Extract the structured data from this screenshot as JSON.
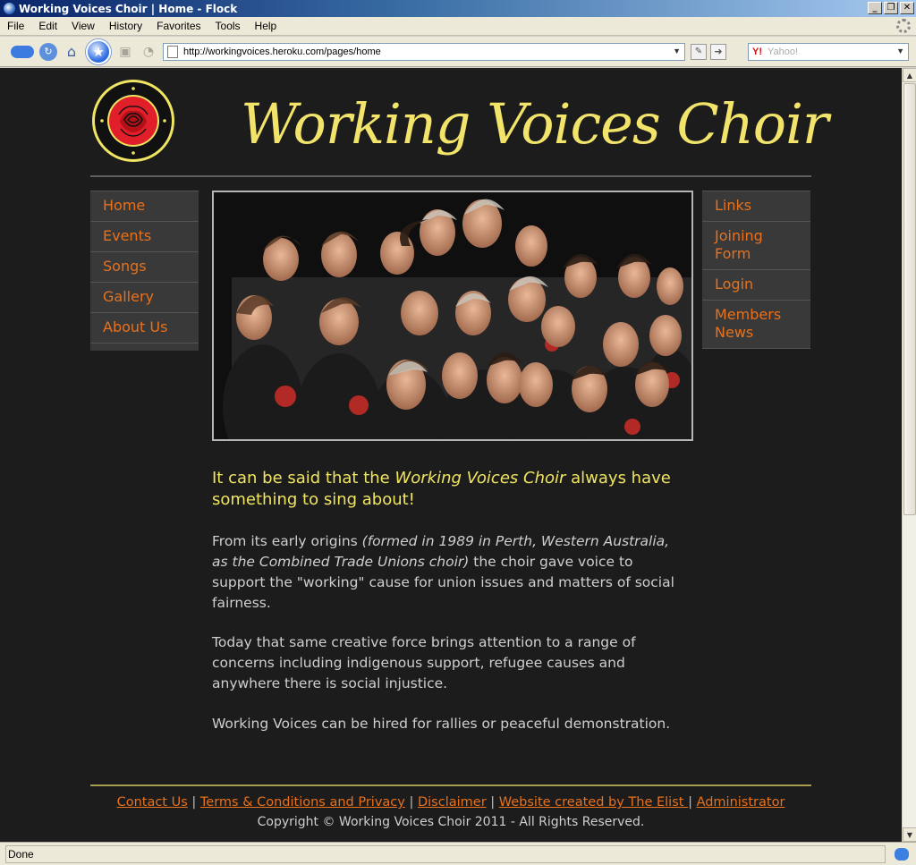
{
  "window": {
    "title": "Working Voices Choir | Home - Flock",
    "controls": {
      "minimize": "_",
      "maximize": "❐",
      "close": "✕"
    }
  },
  "menu": [
    "File",
    "Edit",
    "View",
    "History",
    "Favorites",
    "Tools",
    "Help"
  ],
  "toolbar": {
    "url": "http://workingvoices.heroku.com/pages/home",
    "search_placeholder": "Yahoo!",
    "search_engine_icon": "Y!"
  },
  "site": {
    "title": "Working Voices Choir",
    "logo": {
      "top_text": "RIGHT TO WORK · RIGHT TO REST · RIGHT TO PLAY · RIGHTS FOR ALL",
      "colors": {
        "outer": "#f0e562",
        "ring": "#111111",
        "disc": "#e01f2a"
      }
    }
  },
  "nav_left": [
    "Home",
    "Events",
    "Songs",
    "Gallery",
    "About Us"
  ],
  "nav_right": [
    "Links",
    "Joining Form",
    "Login",
    "Members News"
  ],
  "content": {
    "intro_before": "It can be said that the ",
    "intro_em": "Working Voices Choir",
    "intro_after": " always have something to sing about!",
    "p1_before": "From its early origins ",
    "p1_em": "(formed in 1989 in Perth, Western Australia, as the Combined Trade Unions choir)",
    "p1_after": " the choir gave voice to support the \"working\" cause for union issues and matters of social fairness.",
    "p2": "Today that same creative force brings attention to a range of concerns including indigenous support, refugee causes and anywhere there is social injustice.",
    "p3": "Working Voices can be hired for rallies or peaceful demonstration."
  },
  "footer": {
    "links": [
      "Contact Us",
      "Terms & Conditions and Privacy",
      "Disclaimer",
      "Website created by The Elist ",
      "Administrator"
    ],
    "separator": " | ",
    "copyright": "Copyright © Working Voices Choir 2011 - All Rights Reserved."
  },
  "status": {
    "text": "Done"
  },
  "colors": {
    "accent": "#e8711c",
    "title": "#f2e36a",
    "background": "#1c1c1c",
    "nav_bg": "#393939"
  }
}
